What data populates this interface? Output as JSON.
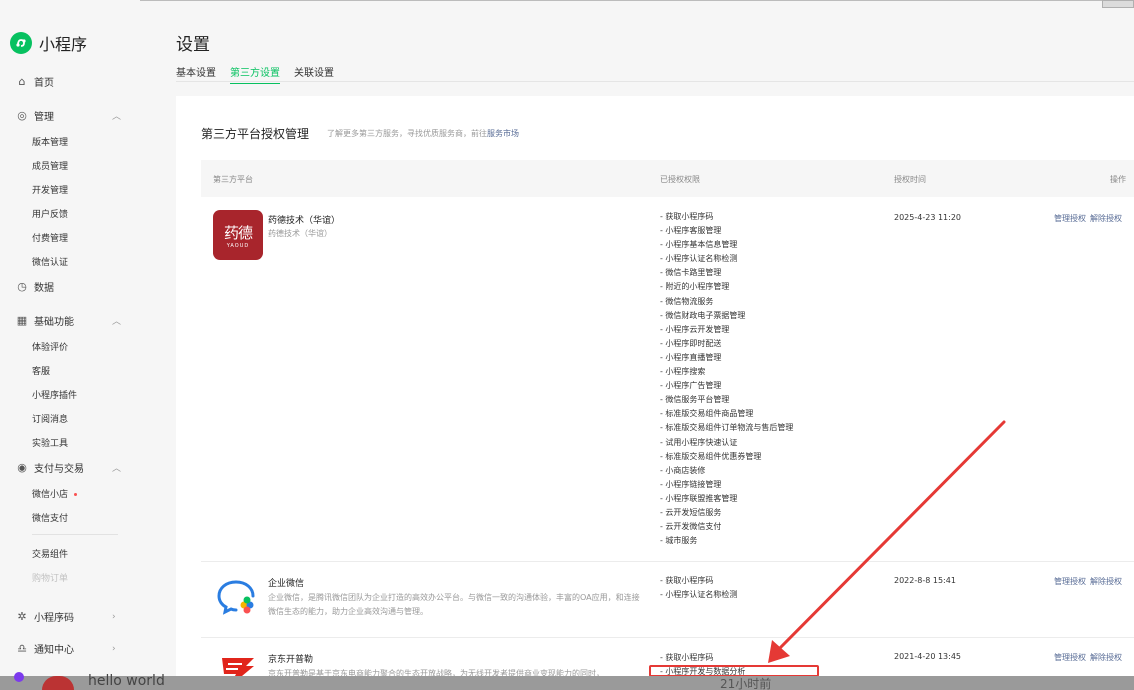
{
  "app": {
    "logo_text": "小程序"
  },
  "sidebar": {
    "home": "首页",
    "manage": {
      "label": "管理",
      "items": [
        "版本管理",
        "成员管理",
        "开发管理",
        "用户反馈",
        "付费管理",
        "微信认证"
      ]
    },
    "data": "数据",
    "basic": {
      "label": "基础功能",
      "items": [
        "体验评价",
        "客服",
        "小程序插件",
        "订阅消息",
        "实验工具"
      ]
    },
    "pay": {
      "label": "支付与交易",
      "items": [
        "微信小店",
        "微信支付",
        "交易组件",
        "购物订单"
      ]
    },
    "mp_code": "小程序码",
    "notice": "通知中心"
  },
  "page": {
    "title": "设置",
    "tabs": [
      "基本设置",
      "第三方设置",
      "关联设置"
    ]
  },
  "section": {
    "title": "第三方平台授权管理",
    "desc": "了解更多第三方服务，寻找优质服务商，前往",
    "link": "服务市场"
  },
  "table": {
    "headers": [
      "第三方平台",
      "已授权权限",
      "授权时间",
      "操作"
    ],
    "rows": [
      {
        "name": "药德技术（华谊）",
        "sub": "药德技术（华谊）",
        "icon_text": "药德",
        "icon_sub": "YAOUD",
        "perms": [
          "- 获取小程序码",
          "- 小程序客服管理",
          "- 小程序基本信息管理",
          "- 小程序认证名称检测",
          "- 微信卡路里管理",
          "- 附近的小程序管理",
          "- 微信物流服务",
          "- 微信财政电子票据管理",
          "- 小程序云开发管理",
          "- 小程序即时配送",
          "- 小程序直播管理",
          "- 小程序搜索",
          "- 小程序广告管理",
          "- 微信服务平台管理",
          "- 标准版交易组件商品管理",
          "- 标准版交易组件订单物流与售后管理",
          "- 试用小程序快速认证",
          "- 标准版交易组件优惠券管理",
          "- 小商店装修",
          "- 小程序链接管理",
          "- 小程序联盟推客管理",
          "- 云开发短信服务",
          "- 云开发微信支付",
          "- 城市服务"
        ],
        "time": "2025-4-23 11:20",
        "ops": [
          "管理授权",
          "解除授权"
        ]
      },
      {
        "name": "企业微信",
        "sub": "企业微信，是腾讯微信团队为企业打造的高效办公平台。与微信一致的沟通体验，丰富的OA应用，和连接微信生态的能力，助力企业高效沟通与管理。",
        "perms": [
          "- 获取小程序码",
          "- 小程序认证名称检测"
        ],
        "time": "2022-8-8 15:41",
        "ops": [
          "管理授权",
          "解除授权"
        ]
      },
      {
        "name": "京东开普勒",
        "sub": "京东开普勒是基于京东电商能力聚合的生态开放战略，为无线开发者提供商业变现能力的同时，",
        "perms": [
          "- 获取小程序码",
          "- 小程序开发与数据分析"
        ],
        "time": "2021-4-20 13:45",
        "ops": [
          "管理授权",
          "解除授权"
        ]
      }
    ]
  },
  "overlay": {
    "hello": "hello world",
    "ago": "21小时前"
  },
  "colors": {
    "accent": "#07c160",
    "link": "#576b95",
    "highlight": "#e53935",
    "arrow": "#e53935"
  }
}
